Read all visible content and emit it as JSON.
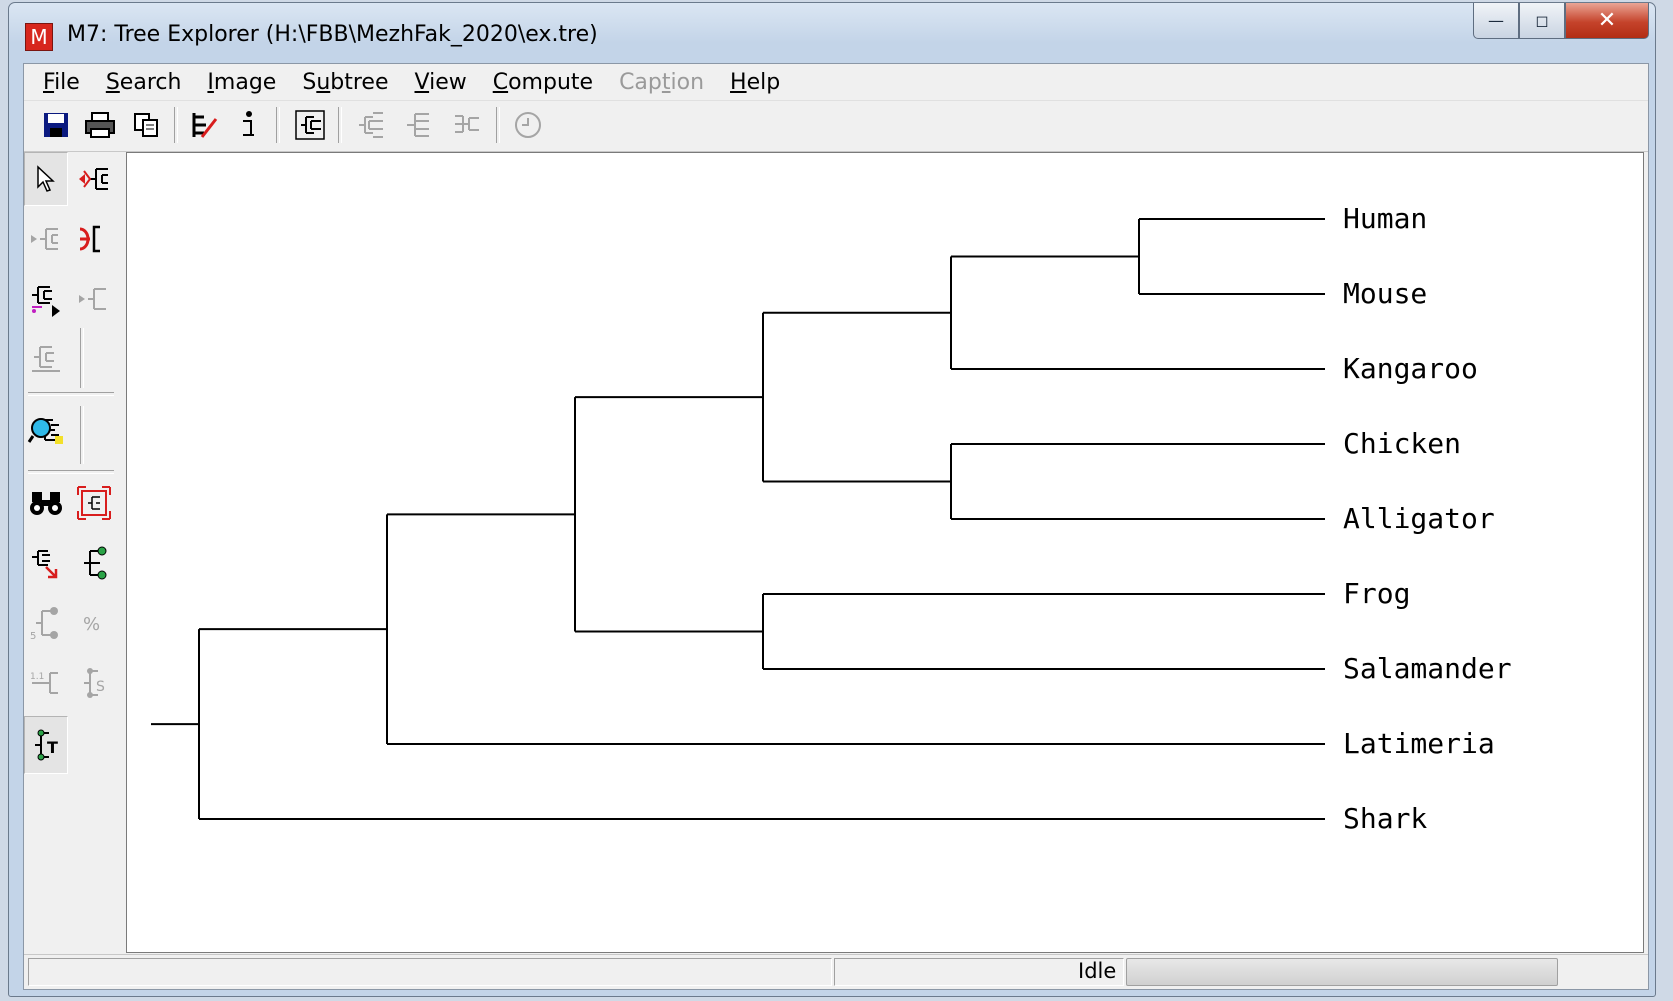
{
  "window": {
    "title": "M7: Tree Explorer (H:\\FBB\\MezhFak_2020\\ex.tre)",
    "app_icon_letter": "M",
    "accent_color": "#d7261d"
  },
  "menu": [
    {
      "label": "File",
      "enabled": true
    },
    {
      "label": "Search",
      "enabled": true
    },
    {
      "label": "Image",
      "enabled": true
    },
    {
      "label": "Subtree",
      "enabled": true
    },
    {
      "label": "View",
      "enabled": true
    },
    {
      "label": "Compute",
      "enabled": true
    },
    {
      "label": "Caption",
      "enabled": false
    },
    {
      "label": "Help",
      "enabled": true
    }
  ],
  "toolbar": [
    {
      "icon": "save-icon",
      "enabled": true
    },
    {
      "icon": "print-icon",
      "enabled": true
    },
    {
      "icon": "copy-icon",
      "enabled": true
    },
    {
      "icon": "tree-options-icon",
      "enabled": true
    },
    {
      "icon": "info-icon",
      "enabled": true
    },
    {
      "icon": "tree-style-icon",
      "enabled": true
    },
    {
      "icon": "tree-style-2-icon",
      "enabled": false
    },
    {
      "icon": "tree-style-3-icon",
      "enabled": false
    },
    {
      "icon": "tree-style-4-icon",
      "enabled": false
    },
    {
      "icon": "clock-icon",
      "enabled": false
    }
  ],
  "sidebar_tools": [
    {
      "icon": "pointer-icon",
      "enabled": true,
      "active": true
    },
    {
      "icon": "reroot-icon",
      "enabled": true
    },
    {
      "icon": "flip-subtree-icon",
      "enabled": false
    },
    {
      "icon": "compress-subtree-icon",
      "enabled": true
    },
    {
      "icon": "swap-subtree-icon",
      "enabled": true
    },
    {
      "icon": "expand-subtree-icon",
      "enabled": false
    },
    {
      "icon": "subtree-options-icon",
      "enabled": false
    },
    {
      "icon": "search-tree-icon",
      "enabled": true
    },
    {
      "icon": "binoculars-icon",
      "enabled": true
    },
    {
      "icon": "fit-to-window-icon",
      "enabled": true
    },
    {
      "icon": "zoom-tree-icon",
      "enabled": true
    },
    {
      "icon": "node-marker-icon",
      "enabled": true
    },
    {
      "icon": "branch-length-icon",
      "enabled": false
    },
    {
      "icon": "percent-icon",
      "enabled": false
    },
    {
      "icon": "scale-bar-icon",
      "enabled": false
    },
    {
      "icon": "bootstrap-icon",
      "enabled": false
    },
    {
      "icon": "topology-icon",
      "enabled": true,
      "active": true
    }
  ],
  "tree": {
    "taxa": [
      "Human",
      "Mouse",
      "Kangaroo",
      "Chicken",
      "Alligator",
      "Frog",
      "Salamander",
      "Latimeria",
      "Shark"
    ],
    "newick": "((((((Human,Mouse),Kangaroo),(Chicken,Alligator)),(Frog,Salamander)),Latimeria),Shark);"
  },
  "status": {
    "text": "Idle",
    "progress": 0
  }
}
